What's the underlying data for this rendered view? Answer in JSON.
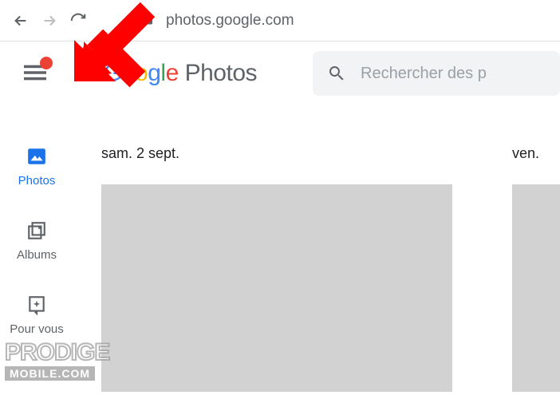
{
  "browser": {
    "url": "photos.google.com"
  },
  "logo": {
    "g": "G",
    "oo1": "o",
    "oo2": "o",
    "g2": "g",
    "l": "l",
    "e": "e",
    "product": " Photos",
    "colors": {
      "G": "#4285F4",
      "o1": "#EA4335",
      "o2": "#FBBC05",
      "g2": "#4285F4",
      "l": "#34A853",
      "e": "#EA4335"
    }
  },
  "search": {
    "placeholder": "Rechercher des p"
  },
  "sidebar": {
    "items": [
      {
        "label": "Photos",
        "active": true
      },
      {
        "label": "Albums",
        "active": false
      },
      {
        "label": "Pour vous",
        "active": false
      }
    ]
  },
  "dates": [
    {
      "label": "sam. 2 sept."
    },
    {
      "label": "ven. "
    }
  ],
  "notification": true,
  "watermark": {
    "line1": "PRODIGE",
    "line2": "MOBILE.COM"
  }
}
